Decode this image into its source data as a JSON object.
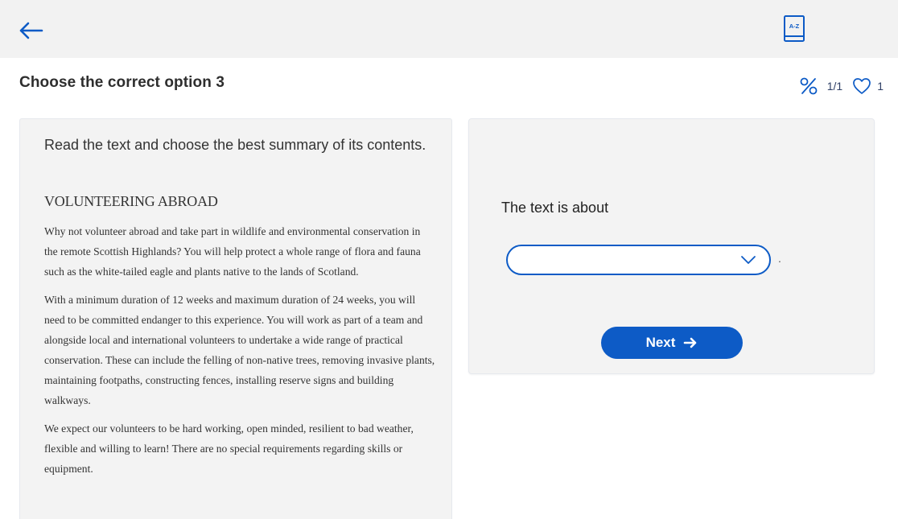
{
  "header": {
    "back_icon": "arrow-left-icon",
    "dictionary_icon": "a-z-dictionary-icon",
    "dictionary_label": "A-Z"
  },
  "page": {
    "title": "Choose the correct option 3"
  },
  "stats": {
    "percent_icon": "percent-icon",
    "progress": "1/1",
    "heart_icon": "heart-icon",
    "likes": "1"
  },
  "text_panel": {
    "instruction": "Read the text and choose the best summary of its contents.",
    "article": {
      "title": "VOLUNTEERING ABROAD",
      "paragraphs": [
        "Why not volunteer abroad and take part in wildlife and environmental conservation in the remote Scottish Highlands? You will help protect a whole range of flora and fauna such as the white-tailed eagle and plants native to the lands of Scotland.",
        "With a minimum duration of 12 weeks and maximum duration of 24 weeks, you will need to be committed endanger to this experience. You will work as part of a team and alongside local and international volunteers to undertake a wide range of practical conservation. These can include the felling of non-native trees, removing invasive plants, maintaining footpaths, constructing fences, installing reserve signs and building walkways.",
        "We expect our volunteers to be hard working, open minded, resilient to bad weather, flexible and willing to learn! There are  no special requirements regarding skills or equipment."
      ]
    }
  },
  "question_panel": {
    "prompt": "The text is about",
    "select_value": "",
    "trailing_punctuation": ".",
    "next_label": "Next",
    "next_icon": "arrow-right-icon"
  },
  "colors": {
    "accent": "#0d5bc6",
    "topbar_bg": "#f2f2f2",
    "panel_bg": "#f3f3f3"
  }
}
